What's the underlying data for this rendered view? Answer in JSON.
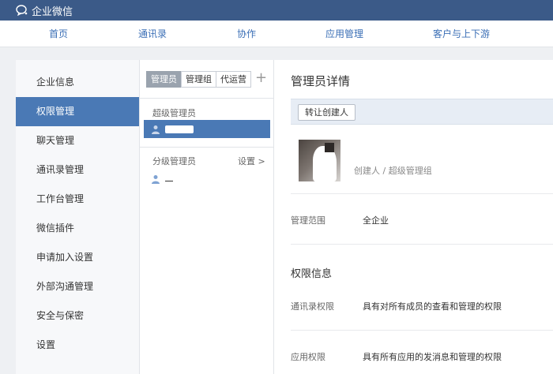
{
  "app": {
    "brand": "企业微信"
  },
  "nav": {
    "items": [
      {
        "label": "首页"
      },
      {
        "label": "通讯录"
      },
      {
        "label": "协作"
      },
      {
        "label": "应用管理"
      },
      {
        "label": "客户与上下游"
      }
    ]
  },
  "sidebar": {
    "items": [
      {
        "label": "企业信息"
      },
      {
        "label": "权限管理",
        "active": true
      },
      {
        "label": "聊天管理"
      },
      {
        "label": "通讯录管理"
      },
      {
        "label": "工作台管理"
      },
      {
        "label": "微信插件"
      },
      {
        "label": "申请加入设置"
      },
      {
        "label": "外部沟通管理"
      },
      {
        "label": "安全与保密"
      },
      {
        "label": "设置"
      }
    ]
  },
  "middle": {
    "tabs": [
      {
        "label": "管理员",
        "active": true
      },
      {
        "label": "管理组"
      },
      {
        "label": "代运营"
      }
    ],
    "add_symbol": "+",
    "super_admin_label": "超级管理员",
    "sub_admin_label": "分级管理员",
    "settings_link": "设置 >"
  },
  "detail": {
    "title": "管理员详情",
    "transfer_button": "转让创建人",
    "role": "创建人 / 超级管理组",
    "scope_label": "管理范围",
    "scope_value": "全企业",
    "permissions_title": "权限信息",
    "contacts_perm_label": "通讯录权限",
    "contacts_perm_value": "具有对所有成员的查看和管理的权限",
    "apps_perm_label": "应用权限",
    "apps_perm_value": "具有所有应用的发消息和管理的权限"
  },
  "colors": {
    "topbar": "#3b5a88",
    "accent": "#4a79b5",
    "nav_text": "#3b6fb6"
  }
}
